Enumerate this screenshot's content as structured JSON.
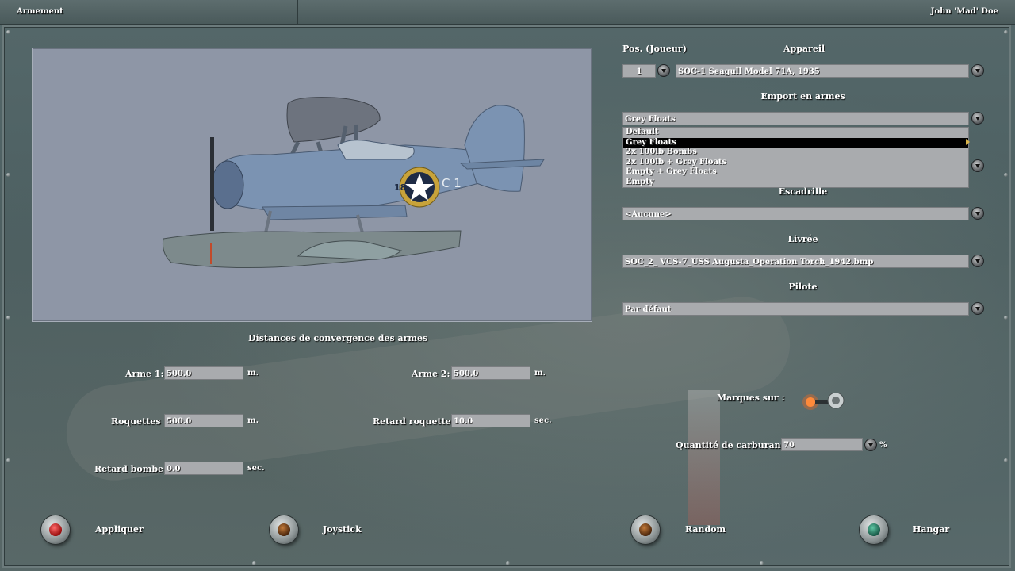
{
  "window": {
    "title": "Armement",
    "user": "John 'Mad' Doe"
  },
  "aircraft": {
    "pos_label": "Pos. (Joueur)",
    "pos_value": "1",
    "plane_label": "Appareil",
    "plane_value": "SOC-1 Seagull Model 71A, 1935",
    "plane_markings": {
      "code": "18",
      "code2": "C 1"
    }
  },
  "loadout": {
    "label": "Emport en armes",
    "value": "Grey Floats",
    "options": [
      "Default",
      "Grey Floats",
      "2x 100lb Bombs",
      "2x 100lb + Grey Floats",
      "Empty + Grey Floats",
      "Empty"
    ],
    "selected_index": 1
  },
  "squadron": {
    "label": "Escadrille",
    "value": "<Aucune>"
  },
  "skin": {
    "label": "Livrée",
    "value": "SOC_2_ VCS-7_USS Augusta_Operation Torch_1942.bmp"
  },
  "pilot": {
    "label": "Pilote",
    "value": "Par défaut"
  },
  "convergence": {
    "title": "Distances de convergence des armes",
    "weapon1_label": "Arme 1:",
    "weapon1_value": "500.0",
    "weapon1_unit": "m.",
    "weapon2_label": "Arme 2:",
    "weapon2_value": "500.0",
    "weapon2_unit": "m.",
    "rockets_label": "Roquettes :",
    "rockets_value": "500.0",
    "rockets_unit": "m.",
    "rocket_delay_label": "Retard roquette :",
    "rocket_delay_value": "10.0",
    "rocket_delay_unit": "sec.",
    "bomb_delay_label": "Retard bombe :",
    "bomb_delay_value": "0.0",
    "bomb_delay_unit": "sec."
  },
  "markings": {
    "label": "Marques sur :",
    "enabled": true
  },
  "fuel": {
    "label": "Quantité de carburant :",
    "value": "70",
    "unit": "%"
  },
  "buttons": {
    "apply": "Appliquer",
    "joystick": "Joystick",
    "random": "Random",
    "hangar": "Hangar"
  }
}
